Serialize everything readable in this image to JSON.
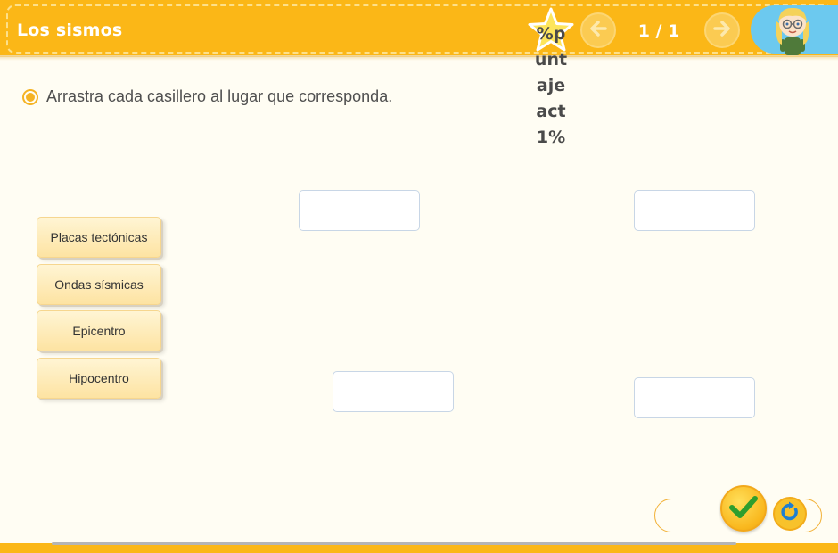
{
  "header": {
    "title": "Los sismos",
    "score_label": "%puntajeact1%",
    "page_counter": "1 / 1",
    "prev_icon": "arrow-left-icon",
    "next_icon": "arrow-right-icon",
    "avatar": "girl-character-avatar"
  },
  "instruction": {
    "text": "Arrastra cada casillero al lugar que corresponda."
  },
  "chips": [
    {
      "label": "Placas tectónicas"
    },
    {
      "label": "Ondas sísmicas"
    },
    {
      "label": "Epicentro"
    },
    {
      "label": "Hipocentro"
    }
  ],
  "drop_zones": [
    {
      "value": ""
    },
    {
      "value": ""
    },
    {
      "value": ""
    },
    {
      "value": ""
    }
  ],
  "controls": {
    "check_icon": "check-icon",
    "reset_icon": "reset-icon"
  },
  "colors": {
    "header": "#fbb717",
    "avatar_panel": "#6cc9ef",
    "check": "#2e9e2e",
    "reset": "#1f7fd0",
    "background": "#fffdf3"
  }
}
